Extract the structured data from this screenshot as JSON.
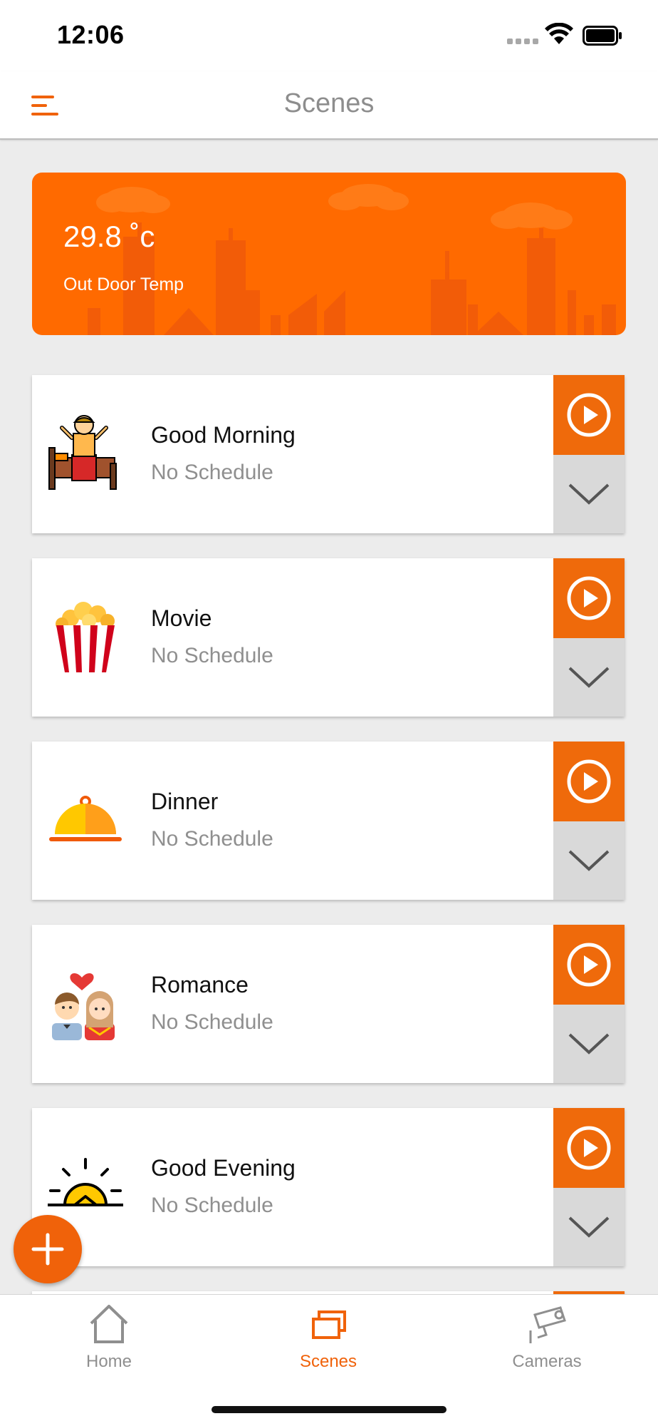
{
  "status_bar": {
    "time": "12:06"
  },
  "header": {
    "title": "Scenes",
    "menu_icon": "hamburger-menu-icon"
  },
  "weather": {
    "temperature": "29.8 ˚c",
    "label": "Out Door Temp",
    "color": "#ff6a00"
  },
  "scenes": [
    {
      "name": "Good Morning",
      "schedule": "No Schedule",
      "icon": "wake-up-bed-icon"
    },
    {
      "name": "Movie",
      "schedule": "No Schedule",
      "icon": "popcorn-icon"
    },
    {
      "name": "Dinner",
      "schedule": "No Schedule",
      "icon": "food-cloche-icon"
    },
    {
      "name": "Romance",
      "schedule": "No Schedule",
      "icon": "couple-heart-icon"
    },
    {
      "name": "Good Evening",
      "schedule": "No Schedule",
      "icon": "sunset-icon"
    }
  ],
  "fab": {
    "icon": "plus-icon"
  },
  "tabs": [
    {
      "label": "Home",
      "icon": "home-icon",
      "active": false
    },
    {
      "label": "Scenes",
      "icon": "scenes-icon",
      "active": true
    },
    {
      "label": "Cameras",
      "icon": "camera-icon",
      "active": false
    }
  ],
  "colors": {
    "accent": "#f0620a",
    "inactive": "#8f8f8f",
    "expand_bg": "#d9d9d9"
  }
}
